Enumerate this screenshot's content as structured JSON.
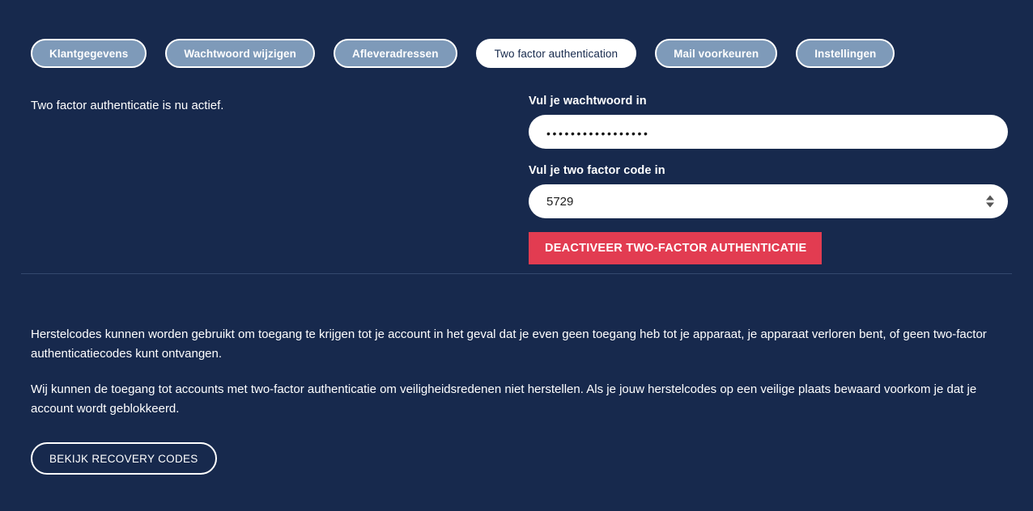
{
  "tabs": [
    {
      "label": "Klantgegevens",
      "active": false
    },
    {
      "label": "Wachtwoord wijzigen",
      "active": false
    },
    {
      "label": "Afleveradressen",
      "active": false
    },
    {
      "label": "Two factor authentication",
      "active": true
    },
    {
      "label": "Mail voorkeuren",
      "active": false
    },
    {
      "label": "Instellingen",
      "active": false
    }
  ],
  "status": {
    "text": "Two factor authenticatie is nu actief."
  },
  "form": {
    "password_label": "Vul je wachtwoord in",
    "password_value": "•••••••••••••••••",
    "password_placeholder": "",
    "code_label": "Vul je two factor code in",
    "code_value": "5729",
    "code_placeholder": "",
    "spinner_up_icon": "triangle-up-icon",
    "spinner_down_icon": "triangle-down-icon",
    "deactivate_button": "DEACTIVEER TWO-FACTOR AUTHENTICATIE"
  },
  "recovery": {
    "paragraph_1": "Herstelcodes kunnen worden gebruikt om toegang te krijgen tot je account in het geval dat je even geen toegang heb tot je apparaat, je apparaat verloren bent, of geen two-factor authenticatiecodes kunt ontvangen.",
    "paragraph_2": "Wij kunnen de toegang tot accounts met two-factor authenticatie om veiligheidsredenen niet herstellen. Als je jouw herstelcodes op een veilige plaats bewaard voorkom je dat je account wordt geblokkeerd.",
    "view_codes_button": "BEKIJK RECOVERY CODES"
  },
  "colors": {
    "background": "#17294d",
    "tab_inactive": "#7e9ab9",
    "tab_active": "#ffffff",
    "danger": "#e23c51",
    "divider": "#34496e",
    "text": "#ffffff"
  }
}
